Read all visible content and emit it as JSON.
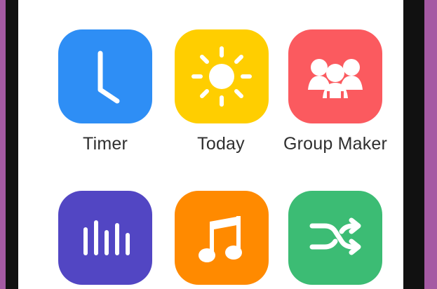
{
  "apps": [
    {
      "label": "Timer",
      "icon": "clock-icon",
      "color": "#2e8ef5"
    },
    {
      "label": "Today",
      "icon": "sun-icon",
      "color": "#ffce00"
    },
    {
      "label": "Group Maker",
      "icon": "group-people-icon",
      "color": "#fb5a5f"
    },
    {
      "label": "",
      "icon": "bar-levels-icon",
      "color": "#5246c3"
    },
    {
      "label": "",
      "icon": "music-note-icon",
      "color": "#ff8a00"
    },
    {
      "label": "",
      "icon": "shuffle-icon",
      "color": "#3cbc74"
    }
  ]
}
